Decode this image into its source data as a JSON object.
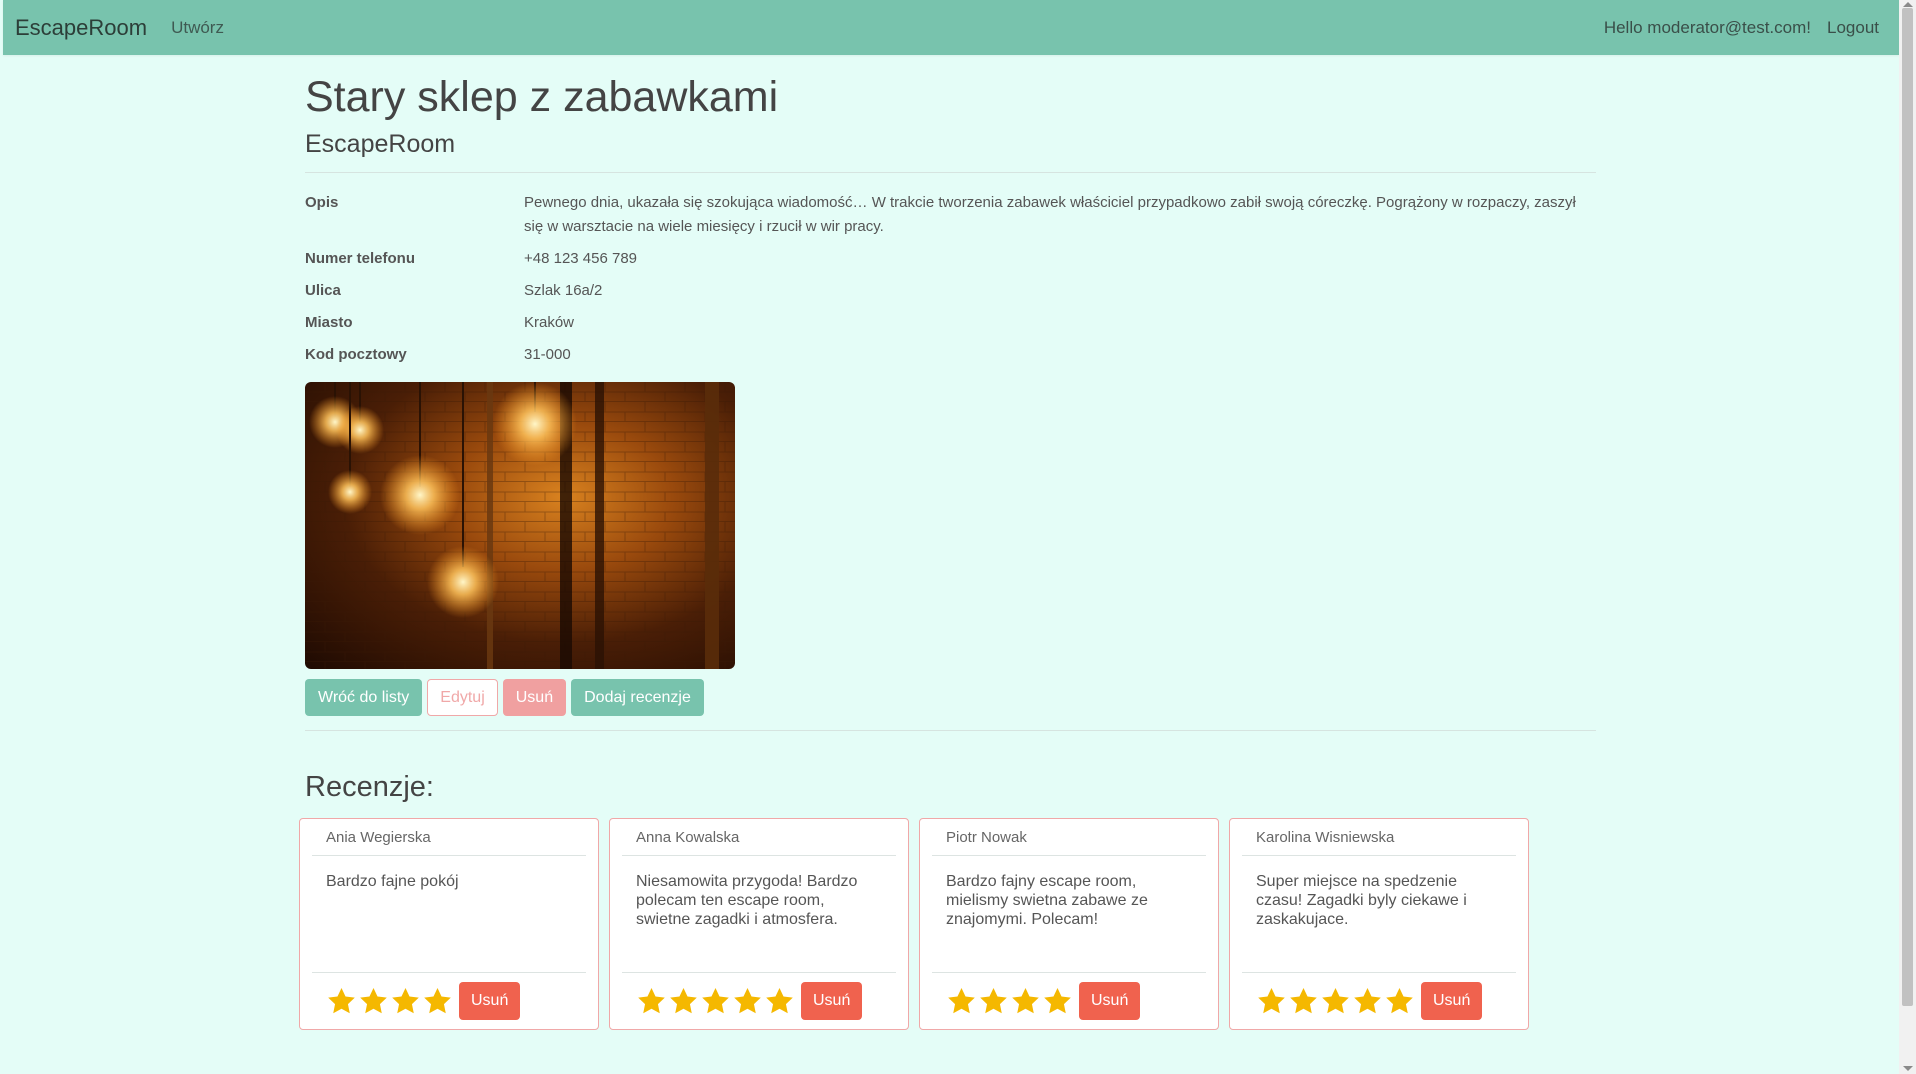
{
  "nav": {
    "brand": "EscapeRoom",
    "create_link": "Utwórz",
    "greeting": "Hello moderator@test.com!",
    "logout": "Logout"
  },
  "room": {
    "title": "Stary sklep z zabawkami",
    "subtitle": "EscapeRoom",
    "details": [
      {
        "label": "Opis",
        "value": "Pewnego dnia, ukazała się szokująca wiadomość… W trakcie tworzenia zabawek właściciel przypadkowo zabił swoją córeczkę. Pogrążony w rozpaczy, zaszył się w warsztacie na wiele miesięcy i rzucił w wir pracy."
      },
      {
        "label": "Numer telefonu",
        "value": "+48 123 456 789"
      },
      {
        "label": "Ulica",
        "value": "Szlak 16a/2"
      },
      {
        "label": "Miasto",
        "value": "Kraków"
      },
      {
        "label": "Kod pocztowy",
        "value": "31-000"
      }
    ],
    "image_icon": "room-photo-lamps"
  },
  "actions": {
    "back": "Wróć do listy",
    "edit": "Edytuj",
    "delete": "Usuń",
    "add_review": "Dodaj recenzje"
  },
  "reviews_heading": "Recenzje:",
  "reviews": [
    {
      "author": "Ania Wegierska",
      "text": "Bardzo fajne pokój",
      "rating": 4,
      "delete": "Usuń"
    },
    {
      "author": "Anna Kowalska",
      "text": "Niesamowita przygoda! Bardzo polecam ten escape room, swietne zagadki i atmosfera.",
      "rating": 5,
      "delete": "Usuń"
    },
    {
      "author": "Piotr Nowak",
      "text": "Bardzo fajny escape room, mielismy swietna zabawe ze znajomymi. Polecam!",
      "rating": 4,
      "delete": "Usuń"
    },
    {
      "author": "Karolina Wisniewska",
      "text": "Super miejsce na spedzenie czasu! Zagadki byly ciekawe i zaskakujace.",
      "rating": 5,
      "delete": "Usuń"
    }
  ],
  "colors": {
    "navbar": "#78c3ad",
    "background": "#e4fdf7",
    "star": "#f5b800",
    "danger": "#f0624e"
  }
}
